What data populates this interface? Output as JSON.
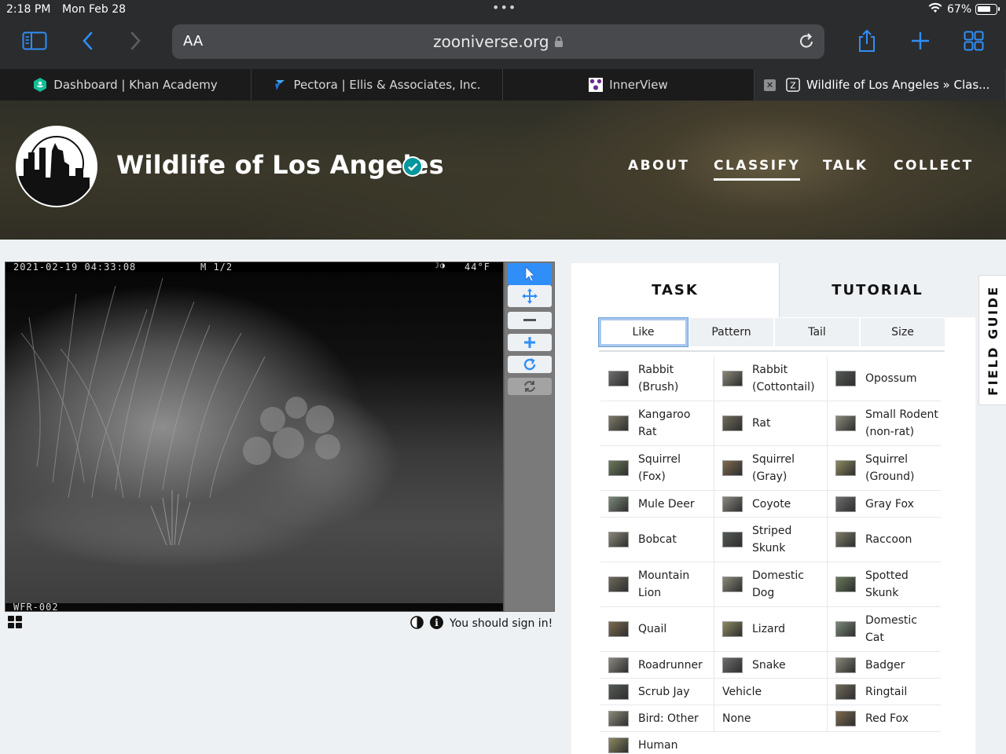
{
  "status": {
    "time": "2:18 PM",
    "date": "Mon Feb 28",
    "battery": "67%"
  },
  "browser": {
    "aa_label": "AA",
    "domain": "zooniverse.org",
    "tabs": [
      {
        "label": "Dashboard | Khan Academy"
      },
      {
        "label": "Pectora | Ellis & Associates, Inc."
      },
      {
        "label": "InnerView"
      },
      {
        "label": "Wildlife of Los Angeles » Clas..."
      }
    ]
  },
  "project": {
    "title": "Wildlife of Los Angeles",
    "nav": [
      "ABOUT",
      "CLASSIFY",
      "TALK",
      "COLLECT"
    ],
    "active_nav": "CLASSIFY"
  },
  "subject": {
    "timestamp": "2021-02-19 04:33:08",
    "frame": "M 1/2",
    "moon": "☽◑",
    "temperature": "44°F",
    "camera_id": "WFR-002"
  },
  "below_subject": {
    "signin_text": "You should sign in!",
    "info_glyph": "i"
  },
  "panel": {
    "tabs": [
      "TASK",
      "TUTORIAL"
    ],
    "filters": [
      "Like",
      "Pattern",
      "Tail",
      "Size"
    ],
    "active_filter": "Like",
    "choices": [
      [
        "Rabbit\n(Brush)",
        "Rabbit\n(Cottontail)",
        "Opossum"
      ],
      [
        "Kangaroo\nRat",
        "Rat",
        "Small Rodent\n(non-rat)"
      ],
      [
        "Squirrel\n(Fox)",
        "Squirrel\n(Gray)",
        "Squirrel\n(Ground)"
      ],
      [
        "Mule Deer",
        "Coyote",
        "Gray Fox"
      ],
      [
        "Bobcat",
        "Striped\nSkunk",
        "Raccoon"
      ],
      [
        "Mountain\nLion",
        "Domestic\nDog",
        "Spotted\nSkunk"
      ],
      [
        "Quail",
        "Lizard",
        "Domestic\nCat"
      ],
      [
        "Roadrunner",
        "Snake",
        "Badger"
      ],
      [
        "Scrub Jay",
        "Vehicle",
        "Ringtail"
      ],
      [
        "Bird: Other",
        "None",
        "Red Fox"
      ],
      [
        "Human",
        "",
        ""
      ]
    ]
  },
  "field_guide": "FIELD GUIDE",
  "colors": {
    "accent": "#2f8ef7",
    "verified": "#00979d"
  }
}
